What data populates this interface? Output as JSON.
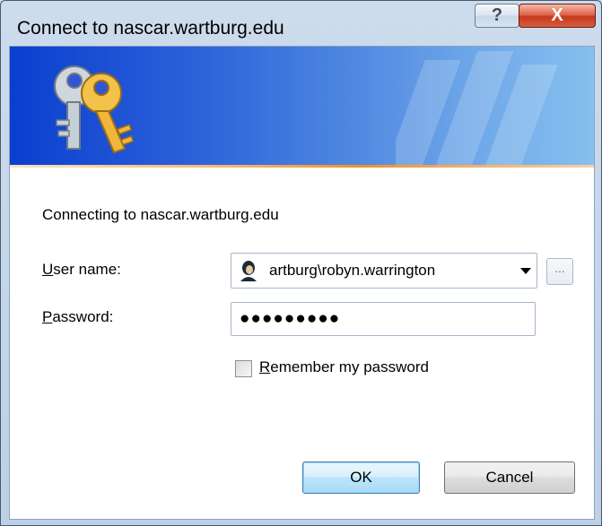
{
  "window": {
    "title": "Connect to nascar.wartburg.edu",
    "help_glyph": "?",
    "close_glyph": "X"
  },
  "banner": {
    "icon": "keys-icon"
  },
  "dialog": {
    "connecting_text": "Connecting to nascar.wartburg.edu",
    "username_label_accel": "U",
    "username_label_rest": "ser name:",
    "username_value": "artburg\\robyn.warrington",
    "browse_label": "...",
    "password_label_accel": "P",
    "password_label_rest": "assword:",
    "password_masked": "●●●●●●●●●",
    "remember_accel": "R",
    "remember_rest": "emember my password",
    "remember_checked": false,
    "ok_label": "OK",
    "cancel_label": "Cancel"
  },
  "colors": {
    "banner_start": "#0a3fcf",
    "banner_end": "#86c0ef",
    "accent_line": "#f0902c",
    "close_button": "#c8391f"
  }
}
